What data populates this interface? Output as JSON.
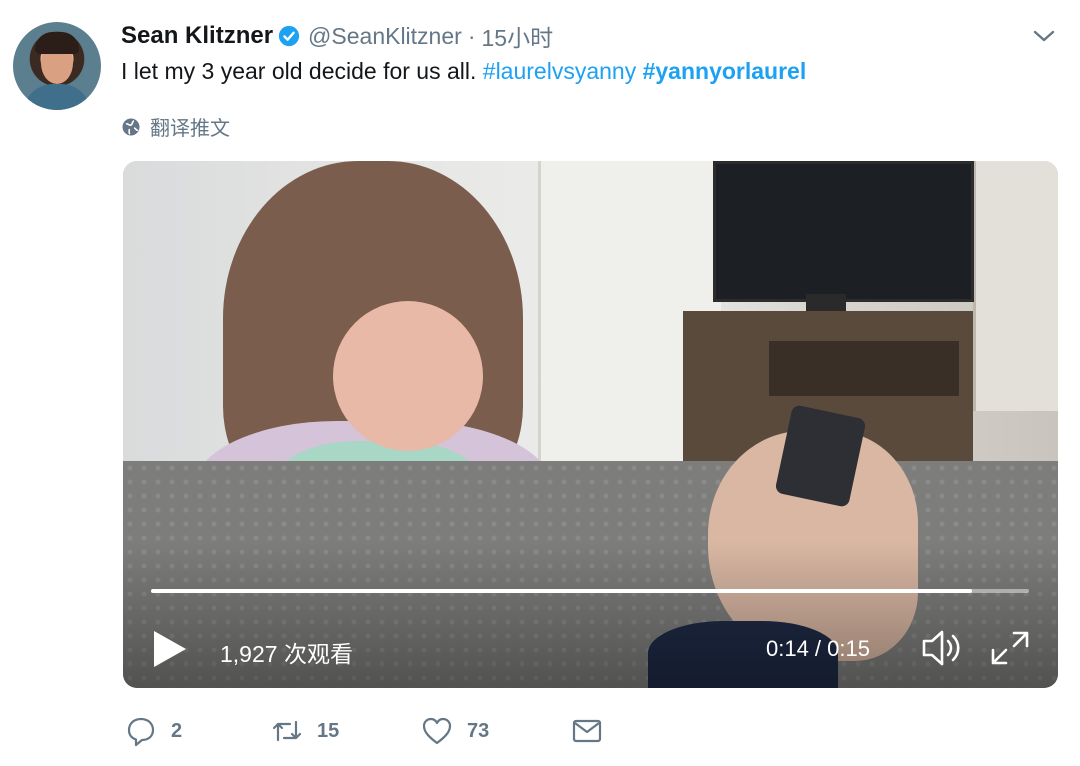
{
  "tweet": {
    "author_name": "Sean Klitzner",
    "handle": "@SeanKlitzner",
    "separator": "·",
    "time": "15小时",
    "text": "I let my 3 year old decide for us all.",
    "hashtags": [
      "#laurelvsyanny",
      "#yannyorlaurel"
    ],
    "translate_label": "翻译推文"
  },
  "icons": {
    "verified": "verified-badge-icon",
    "menu": "chevron-down-icon",
    "translate": "globe-icon",
    "play": "play-icon",
    "volume": "volume-icon",
    "fullscreen": "fullscreen-icon",
    "reply": "reply-icon",
    "retweet": "retweet-icon",
    "like": "heart-icon",
    "dm": "envelope-icon"
  },
  "video": {
    "views": "1,927 次观看",
    "timecode": "0:14 / 0:15",
    "progress": 0.935
  },
  "actions": {
    "reply_count": "2",
    "retweet_count": "15",
    "like_count": "73"
  },
  "colors": {
    "accent": "#1da1f2",
    "secondary_text": "#657786",
    "primary_text": "#14171a"
  }
}
